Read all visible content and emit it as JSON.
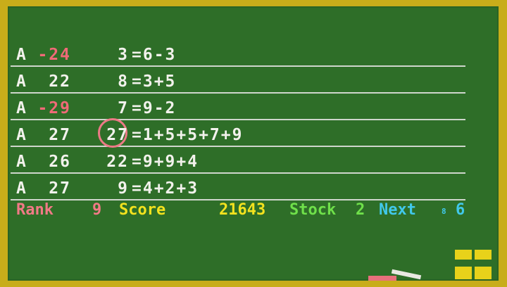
{
  "rows": [
    {
      "grade": "A",
      "score": "-24",
      "negative": true,
      "lhs": "3",
      "rhs": "=6-3",
      "circled": false
    },
    {
      "grade": "A",
      "score": "22",
      "negative": false,
      "lhs": "8",
      "rhs": "=3+5",
      "circled": false
    },
    {
      "grade": "A",
      "score": "-29",
      "negative": true,
      "lhs": "7",
      "rhs": "=9-2",
      "circled": false
    },
    {
      "grade": "A",
      "score": "27",
      "negative": false,
      "lhs": "27",
      "rhs": "=1+5+5+7+9",
      "circled": true
    },
    {
      "grade": "A",
      "score": "26",
      "negative": false,
      "lhs": "22",
      "rhs": "=9+9+4",
      "circled": false
    },
    {
      "grade": "A",
      "score": "27",
      "negative": false,
      "lhs": "9",
      "rhs": "=4+2+3",
      "circled": false
    }
  ],
  "status": {
    "rank_label": "Rank",
    "rank_value": "9",
    "score_label": "Score",
    "score_value": "21643",
    "stock_label": "Stock",
    "stock_value": "2",
    "next_label": "Next",
    "next_small": "8",
    "next_value": "6"
  },
  "colors": {
    "board": "#2e6e28",
    "frame": "#c8ad1a",
    "chalk_white": "#f2f2ec",
    "chalk_pink": "#f06a78",
    "rank": "#f27a86",
    "score": "#f3e21e",
    "stock": "#6fe04a",
    "next": "#41c8ea"
  }
}
